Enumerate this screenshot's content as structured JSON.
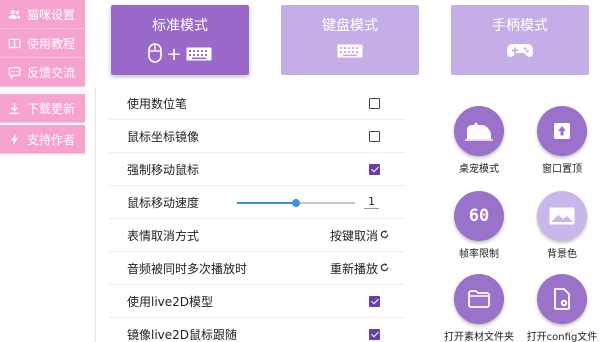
{
  "sidebar": {
    "items": [
      {
        "label": "猫咪设置",
        "icon": "users-icon"
      },
      {
        "label": "使用教程",
        "icon": "book-icon"
      },
      {
        "label": "反馈交流",
        "icon": "chat-icon"
      },
      {
        "label": "下载更新",
        "icon": "download-icon"
      },
      {
        "label": "支持作者",
        "icon": "bolt-icon"
      }
    ]
  },
  "modes": [
    {
      "label": "标准模式",
      "active": true
    },
    {
      "label": "键盘模式",
      "active": false
    },
    {
      "label": "手柄模式",
      "active": false
    }
  ],
  "settings": [
    {
      "label": "使用数位笔",
      "type": "checkbox",
      "checked": false
    },
    {
      "label": "鼠标坐标镜像",
      "type": "checkbox",
      "checked": false
    },
    {
      "label": "强制移动鼠标",
      "type": "checkbox",
      "checked": true
    },
    {
      "label": "鼠标移动速度",
      "type": "slider",
      "value": "1",
      "level": 0.5
    },
    {
      "label": "表情取消方式",
      "type": "cycle",
      "value": "按键取消"
    },
    {
      "label": "音频被同时多次播放时",
      "type": "cycle",
      "value": "重新播放"
    },
    {
      "label": "使用live2D模型",
      "type": "checkbox",
      "checked": true
    },
    {
      "label": "镜像live2D鼠标跟随",
      "type": "checkbox",
      "checked": true
    }
  ],
  "actions": [
    {
      "label": "桌宠模式",
      "icon": "desk-pet-icon"
    },
    {
      "label": "窗口置顶",
      "icon": "pin-top-icon"
    },
    {
      "label": "帧率限制",
      "icon": "fps-icon",
      "text": "60"
    },
    {
      "label": "背景色",
      "icon": "image-icon"
    },
    {
      "label": "打开素材文件夹",
      "icon": "folder-icon"
    },
    {
      "label": "打开config文件",
      "icon": "config-file-icon"
    }
  ],
  "colors": {
    "sidebar": "#f7a3cf",
    "mode_active": "#9a69c9",
    "mode_inactive": "#c5aee6",
    "accent": "#6a3fa6",
    "slider": "#3d8fe0"
  }
}
